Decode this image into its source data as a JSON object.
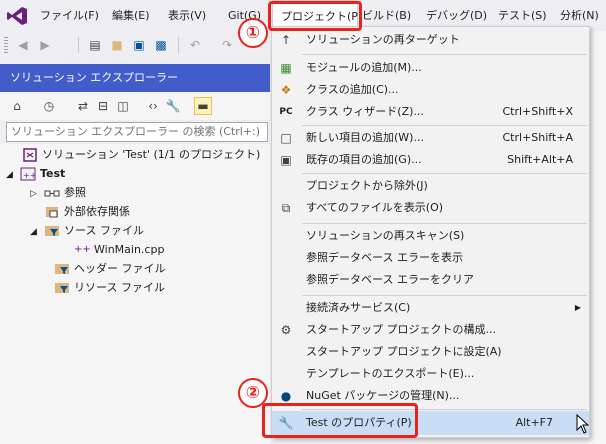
{
  "menubar": {
    "items": [
      "ファイル(F)",
      "編集(E)",
      "表示(V)",
      "Git(G)",
      "プロジェクト(P)",
      "ビルド(B)",
      "デバッグ(D)",
      "テスト(S)",
      "分析(N)"
    ]
  },
  "toolbar": {
    "right_fragment": "ッカ"
  },
  "solution_explorer": {
    "title": "ソリューション エクスプローラー",
    "search_placeholder": "ソリューション エクスプローラー の検索 (Ctrl+:)",
    "tree": [
      {
        "label": "ソリューション 'Test' (1/1 のプロジェクト)",
        "icon": "solution-icon"
      },
      {
        "label": "Test",
        "icon": "cpp-project-icon"
      },
      {
        "label": "参照",
        "icon": "references-icon"
      },
      {
        "label": "外部依存関係",
        "icon": "external-deps-icon"
      },
      {
        "label": "ソース ファイル",
        "icon": "filter-folder-icon"
      },
      {
        "label": "WinMain.cpp",
        "icon": "cpp-file-icon"
      },
      {
        "label": "ヘッダー ファイル",
        "icon": "filter-folder-icon"
      },
      {
        "label": "リソース ファイル",
        "icon": "filter-folder-icon"
      }
    ]
  },
  "project_menu": {
    "items": [
      {
        "label": "ソリューションの再ターゲット",
        "shortcut": "",
        "icon": "retarget-icon"
      },
      {
        "label": "モジュールの追加(M)...",
        "shortcut": "",
        "icon": "add-module-icon"
      },
      {
        "label": "クラスの追加(C)...",
        "shortcut": "",
        "icon": "add-class-icon"
      },
      {
        "label": "クラス ウィザード(Z)...",
        "shortcut": "Ctrl+Shift+X",
        "icon": "class-wizard-icon"
      },
      {
        "label": "新しい項目の追加(W)...",
        "shortcut": "Ctrl+Shift+A",
        "icon": "new-item-icon"
      },
      {
        "label": "既存の項目の追加(G)...",
        "shortcut": "Shift+Alt+A",
        "icon": "existing-item-icon"
      },
      {
        "label": "プロジェクトから除外(J)",
        "shortcut": "",
        "icon": ""
      },
      {
        "label": "すべてのファイルを表示(O)",
        "shortcut": "",
        "icon": "show-all-files-icon"
      },
      {
        "label": "ソリューションの再スキャン(S)",
        "shortcut": "",
        "icon": ""
      },
      {
        "label": "参照データベース エラーを表示",
        "shortcut": "",
        "icon": ""
      },
      {
        "label": "参照データベース エラーをクリア",
        "shortcut": "",
        "icon": ""
      },
      {
        "label": "接続済みサービス(C)",
        "shortcut": "",
        "icon": ""
      },
      {
        "label": "スタートアップ プロジェクトの構成...",
        "shortcut": "",
        "icon": "gear-icon"
      },
      {
        "label": "スタートアップ プロジェクトに設定(A)",
        "shortcut": "",
        "icon": ""
      },
      {
        "label": "テンプレートのエクスポート(E)...",
        "shortcut": "",
        "icon": ""
      },
      {
        "label": "NuGet パッケージの管理(N)...",
        "shortcut": "",
        "icon": "nuget-icon"
      },
      {
        "label": "Test のプロパティ(P)",
        "shortcut": "Alt+F7",
        "icon": "wrench-icon"
      }
    ]
  },
  "callouts": {
    "one": "①",
    "two": "②"
  },
  "colors": {
    "title_bar": "#425cc9",
    "callout_red": "#e8231e",
    "highlight": "#c9def5"
  }
}
